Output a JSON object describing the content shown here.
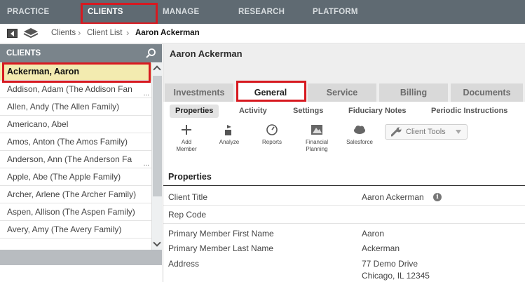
{
  "topnav": {
    "items": [
      "PRACTICE",
      "CLIENTS",
      "MANAGE",
      "RESEARCH",
      "PLATFORM"
    ]
  },
  "breadcrumb": {
    "items": [
      "Clients",
      "Client List",
      "Aaron Ackerman"
    ]
  },
  "sidebar": {
    "title": "CLIENTS",
    "clients": [
      "Ackerman, Aaron",
      "Addison, Adam (The Addison Fan",
      "Allen, Andy (The Allen Family)",
      "Americano, Abel",
      "Amos, Anton (The Amos Family)",
      "Anderson, Ann (The Anderson Fa",
      "Apple, Abe (The Apple Family)",
      "Archer, Arlene (The Archer Family)",
      "Aspen, Allison (The Aspen Family)",
      "Avery, Amy (The Avery Family)"
    ],
    "ellipsis": "..."
  },
  "main": {
    "client_name": "Aaron Ackerman",
    "tabs": [
      "Investments",
      "General",
      "Service",
      "Billing",
      "Documents"
    ],
    "subtabs": [
      "Properties",
      "Activity",
      "Settings",
      "Fiduciary Notes",
      "Periodic Instructions"
    ],
    "tools": [
      {
        "line1": "Add",
        "line2": "Member"
      },
      {
        "line1": "Analyze",
        "line2": ""
      },
      {
        "line1": "Reports",
        "line2": ""
      },
      {
        "line1": "Financial",
        "line2": "Planning"
      },
      {
        "line1": "Salesforce",
        "line2": ""
      }
    ],
    "client_tools_label": "Client Tools",
    "section_title": "Properties",
    "properties": [
      {
        "label": "Client Title",
        "value": "Aaron Ackerman"
      },
      {
        "label": "Rep Code",
        "value": ""
      },
      {
        "label": "Primary Member First Name",
        "value": "Aaron"
      },
      {
        "label": "Primary Member Last Name",
        "value": "Ackerman"
      },
      {
        "label": "Address",
        "value": "77 Demo Drive",
        "value2": "Chicago, IL 12345"
      }
    ],
    "info_glyph": "i"
  },
  "colors": {
    "nav_bg": "#5f6a72",
    "highlight_box": "#d71920",
    "selected_row": "#f3ebb0",
    "sidebar_header": "#7a848b"
  }
}
